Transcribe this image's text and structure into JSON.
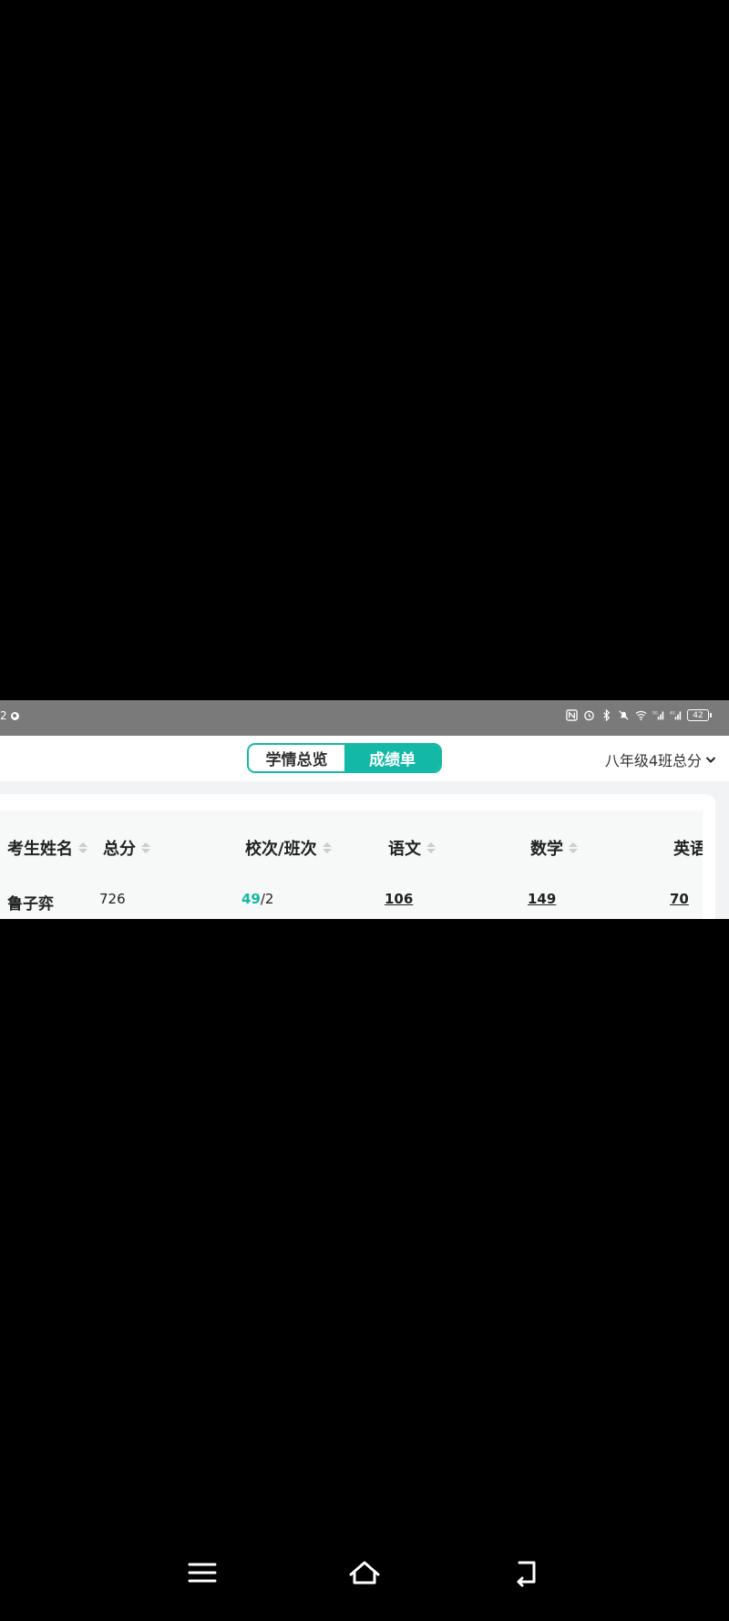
{
  "status_bar": {
    "left_text": "2",
    "battery": "42",
    "icons": [
      "nfc-icon",
      "alarm-icon",
      "bluetooth-icon",
      "mute-icon",
      "wifi-icon",
      "signal-5g-icon",
      "signal-4g-icon",
      "battery-icon"
    ]
  },
  "header": {
    "tabs": [
      {
        "label": "学情总览",
        "active": false
      },
      {
        "label": "成绩单",
        "active": true
      }
    ],
    "class_selector": "八年级4班总分"
  },
  "table": {
    "columns": [
      {
        "label": "考生姓名",
        "sortable": true
      },
      {
        "label": "总分",
        "sortable": true
      },
      {
        "label": "校次/班次",
        "sortable": true
      },
      {
        "label": "语文",
        "sortable": true
      },
      {
        "label": "数学",
        "sortable": true
      },
      {
        "label": "英语",
        "sortable": true
      }
    ],
    "rows": [
      {
        "name": "鲁子弈",
        "total": "726",
        "school_rank": "49",
        "class_rank": "/2",
        "chinese": "106",
        "math": "149",
        "english": "70"
      }
    ]
  },
  "colors": {
    "accent": "#14b8a6",
    "status_bar": "#7a7a7a",
    "background": "#000000"
  },
  "nav_bar": {
    "icons": [
      "menu-icon",
      "home-icon",
      "back-icon"
    ]
  }
}
